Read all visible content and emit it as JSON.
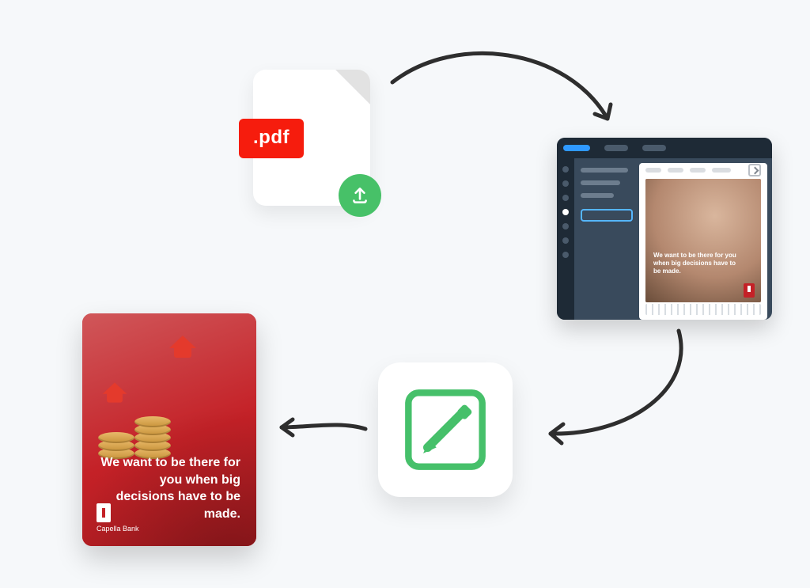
{
  "flow": {
    "pdf": {
      "badge_label": ".pdf",
      "upload_icon": "upload-icon"
    },
    "editor": {
      "canvas_text": "We want to be there for you when big decisions have to be made."
    },
    "output_card": {
      "headline": "We want to be there for you when big decisions have to be made.",
      "brand_name": "Capella Bank"
    }
  }
}
